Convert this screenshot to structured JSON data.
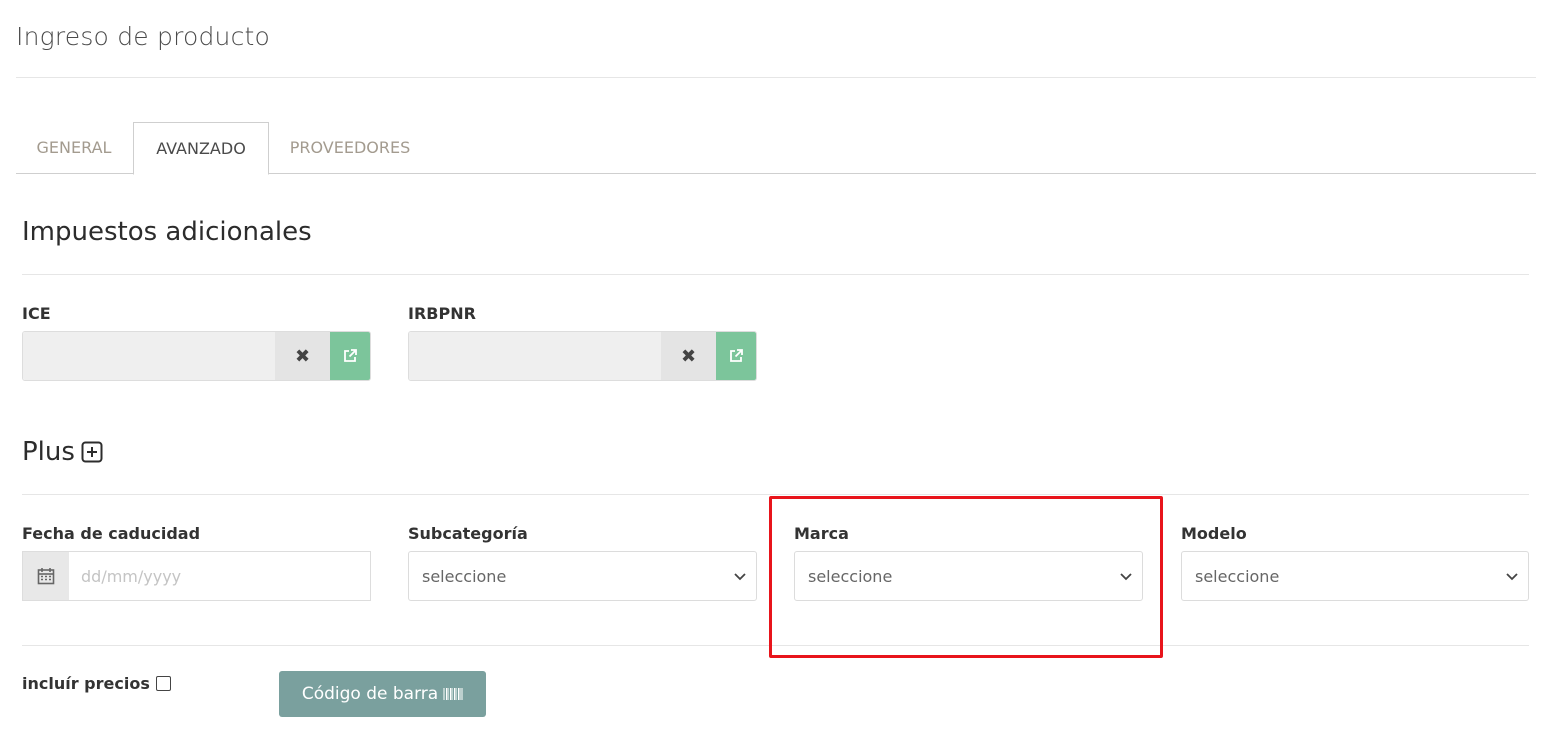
{
  "page": {
    "title": "Ingreso de producto"
  },
  "tabs": [
    {
      "label": "GENERAL"
    },
    {
      "label": "AVANZADO"
    },
    {
      "label": "PROVEEDORES"
    }
  ],
  "impuestos": {
    "title": "Impuestos adicionales",
    "ice": {
      "label": "ICE",
      "value": ""
    },
    "irbpnr": {
      "label": "IRBPNR",
      "value": ""
    }
  },
  "plus": {
    "title": "Plus",
    "fecha": {
      "label": "Fecha de caducidad",
      "placeholder": "dd/mm/yyyy"
    },
    "subcategoria": {
      "label": "Subcategoría",
      "selected": "seleccione"
    },
    "marca": {
      "label": "Marca",
      "selected": "seleccione"
    },
    "modelo": {
      "label": "Modelo",
      "selected": "seleccione"
    }
  },
  "footer": {
    "include_prices_label": "incluír precios",
    "barcode_button": "Código de barra"
  },
  "colors": {
    "open_button": "#7cc59b",
    "barcode_button": "#7aa09e",
    "highlight": "#e8141b"
  }
}
